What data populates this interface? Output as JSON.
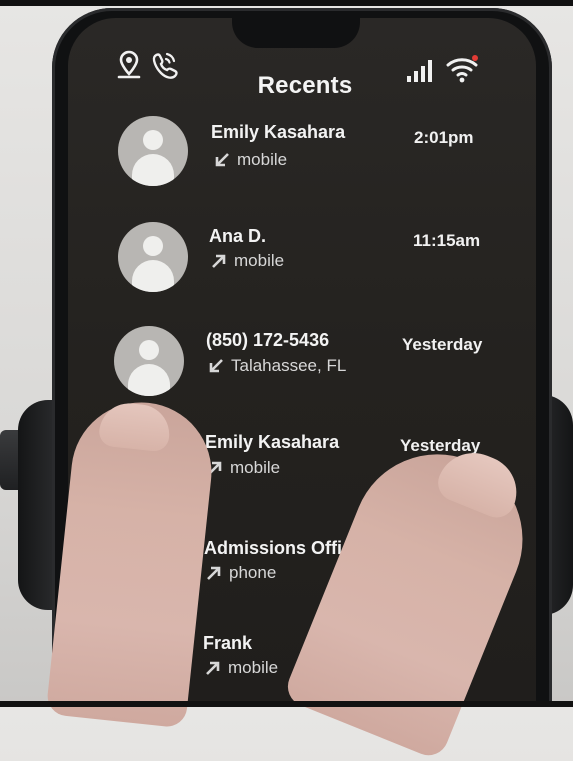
{
  "status_bar": {
    "left_icons": [
      "location-person-icon",
      "phone-call-icon"
    ],
    "right_icons": [
      "signal-bars-icon",
      "wifi-icon"
    ]
  },
  "header": {
    "title": "Recents"
  },
  "calls": [
    {
      "name": "Emily Kasahara",
      "type": "mobile",
      "direction": "incoming",
      "time": "2:01pm",
      "has_avatar": true
    },
    {
      "name": "Ana D.",
      "type": "mobile",
      "direction": "outgoing",
      "time": "11:15am",
      "has_avatar": true
    },
    {
      "name": "(850) 172-5436",
      "type": "Talahassee, FL",
      "direction": "incoming",
      "time": "Yesterday",
      "has_avatar": true
    },
    {
      "name": "Emily Kasahara",
      "type": "mobile",
      "direction": "outgoing",
      "time": "Yesterday",
      "has_avatar": false
    },
    {
      "name": "Admissions Office",
      "type": "phone",
      "direction": "outgoing",
      "time": "",
      "has_avatar": false
    },
    {
      "name": "Frank",
      "type": "mobile",
      "direction": "outgoing",
      "time": "",
      "has_avatar": false
    }
  ],
  "colors": {
    "screen_bg": "#24221f",
    "text_primary": "#f3f3f3",
    "text_secondary": "#d7d7d7",
    "avatar_bg": "#b8b6b3"
  }
}
